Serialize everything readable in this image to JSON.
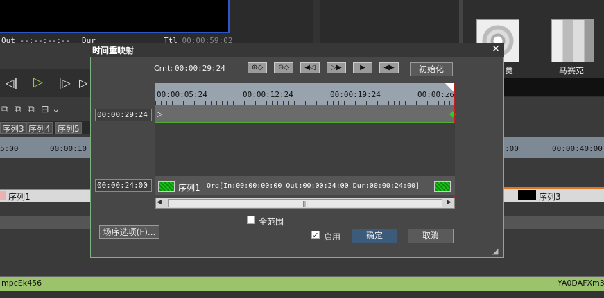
{
  "background": {
    "transport": {
      "out_label": "Out",
      "out_value": "--:--:--:--",
      "dur_label": "Dur",
      "ttl_label": "Ttl",
      "ttl_value": "00:00:59:02"
    },
    "effects": {
      "item1_label": "觉",
      "item2_label": "马赛克"
    },
    "tabs": [
      "序列3",
      "序列4",
      "序列5"
    ],
    "ruler_left": [
      "5:00",
      "00:00:10"
    ],
    "ruler_right": [
      ":00",
      "00:00:40:00"
    ],
    "track_left_clip": "序列1",
    "track_right_clip": "序列3",
    "status_left": "mpcEk456",
    "status_right": "YA0DAFXm3"
  },
  "dialog": {
    "title": "时间重映射",
    "close_glyph": "✕",
    "current_label": "Crnt:",
    "current_value": "00:00:29:24",
    "icon_buttons": [
      "⊕◇",
      "⊖◇",
      "◀◁",
      "▷▶",
      "▶",
      "◀▶"
    ],
    "init_button": "初始化",
    "ruler_ticks": [
      "00:00:05:24",
      "00:00:12:24",
      "00:00:19:24",
      "00:00:26"
    ],
    "upper_timecode": "00:00:29:24",
    "lower_timecode": "00:00:24:00",
    "clip_name": "序列1",
    "clip_info": "Org[In:00:00:00:00 Out:00:00:24:00 Dur:00:00:24:00]",
    "full_range_label": "全范围",
    "full_range_checked": false,
    "enable_label": "启用",
    "enable_checked": true,
    "scene_options_button": "场序选项(F)...",
    "ok_button": "确定",
    "cancel_button": "取消"
  }
}
